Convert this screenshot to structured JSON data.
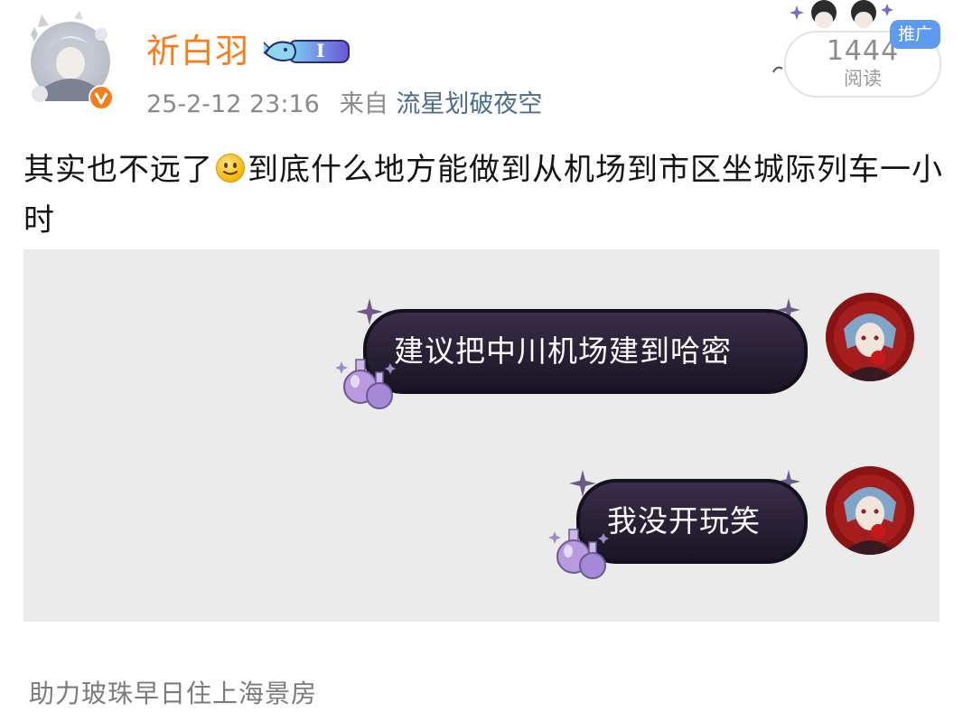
{
  "post": {
    "author": {
      "name": "祈白羽",
      "verified": true,
      "level_badge": "I"
    },
    "meta": {
      "timestamp": "25-2-12 23:16",
      "source_prefix": "来自",
      "source_name": "流星划破夜空"
    },
    "read": {
      "count": "1444",
      "label": "阅读",
      "promo_label": "推广"
    },
    "text_part1": "其实也不远了",
    "text_part2": "到底什么地方能做到从机场到市区坐城际列车一小时",
    "image": {
      "bubbles": [
        {
          "text": "建议把中川机场建到哈密"
        },
        {
          "text": "我没开玩笑"
        }
      ]
    },
    "topic": "助力玻珠早日住上海景房"
  },
  "colors": {
    "author_name": "#ff7a16",
    "source_link": "#4a6d8f",
    "meta_gray": "#8a8a8a",
    "card_bg": "#ebebeb",
    "bubble_bg": "#2a2138",
    "promo_blue": "#5d9bf0",
    "verified_orange": "#f27f1b"
  },
  "icons": {
    "verified": "verified-v-icon",
    "level": "whale-level-badge-icon",
    "emoji": "smile-emoji-icon"
  }
}
